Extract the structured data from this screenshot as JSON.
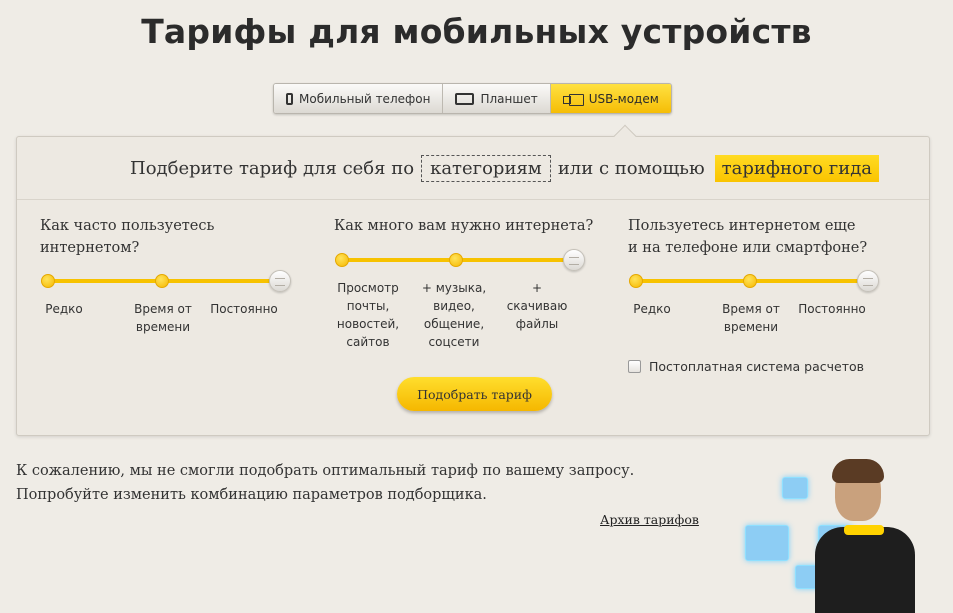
{
  "page": {
    "title": "Тарифы для мобильных устройств"
  },
  "tabs": [
    {
      "label": "Мобильный телефон",
      "icon": "phone-icon",
      "active": false
    },
    {
      "label": "Планшет",
      "icon": "tablet-icon",
      "active": false
    },
    {
      "label": "USB-модем",
      "icon": "usb-modem-icon",
      "active": true
    }
  ],
  "selector": {
    "prefix": "Подберите тариф для себя по",
    "category_link": "категориям",
    "middle": "или с помощью",
    "guide_link": "тарифного гида"
  },
  "filters": [
    {
      "question": "Как часто пользуетесь интернетом?",
      "options": [
        "Редко",
        "Время от времени",
        "Постоянно"
      ],
      "selected_index": 2
    },
    {
      "question": "Как много вам нужно интернета?",
      "options": [
        "Просмотр почты, новостей, сайтов",
        "+ музыка, видео, общение, соцсети",
        "+ скачиваю файлы"
      ],
      "selected_index": 2
    },
    {
      "question": "Пользуетесь интернетом еще и на телефоне или смартфоне?",
      "options": [
        "Редко",
        "Время от времени",
        "Постоянно"
      ],
      "selected_index": 2
    }
  ],
  "postpaid": {
    "label": "Постоплатная система расчетов",
    "checked": false
  },
  "select_button": "Подобрать тариф",
  "result": {
    "message": "К сожалению, мы не смогли подобрать оптимальный тариф по вашему запросу. Попробуйте изменить комбинацию параметров подборщика."
  },
  "archive_link": "Архив тарифов",
  "colors": {
    "accent": "#ffd200",
    "background": "#efece6"
  }
}
